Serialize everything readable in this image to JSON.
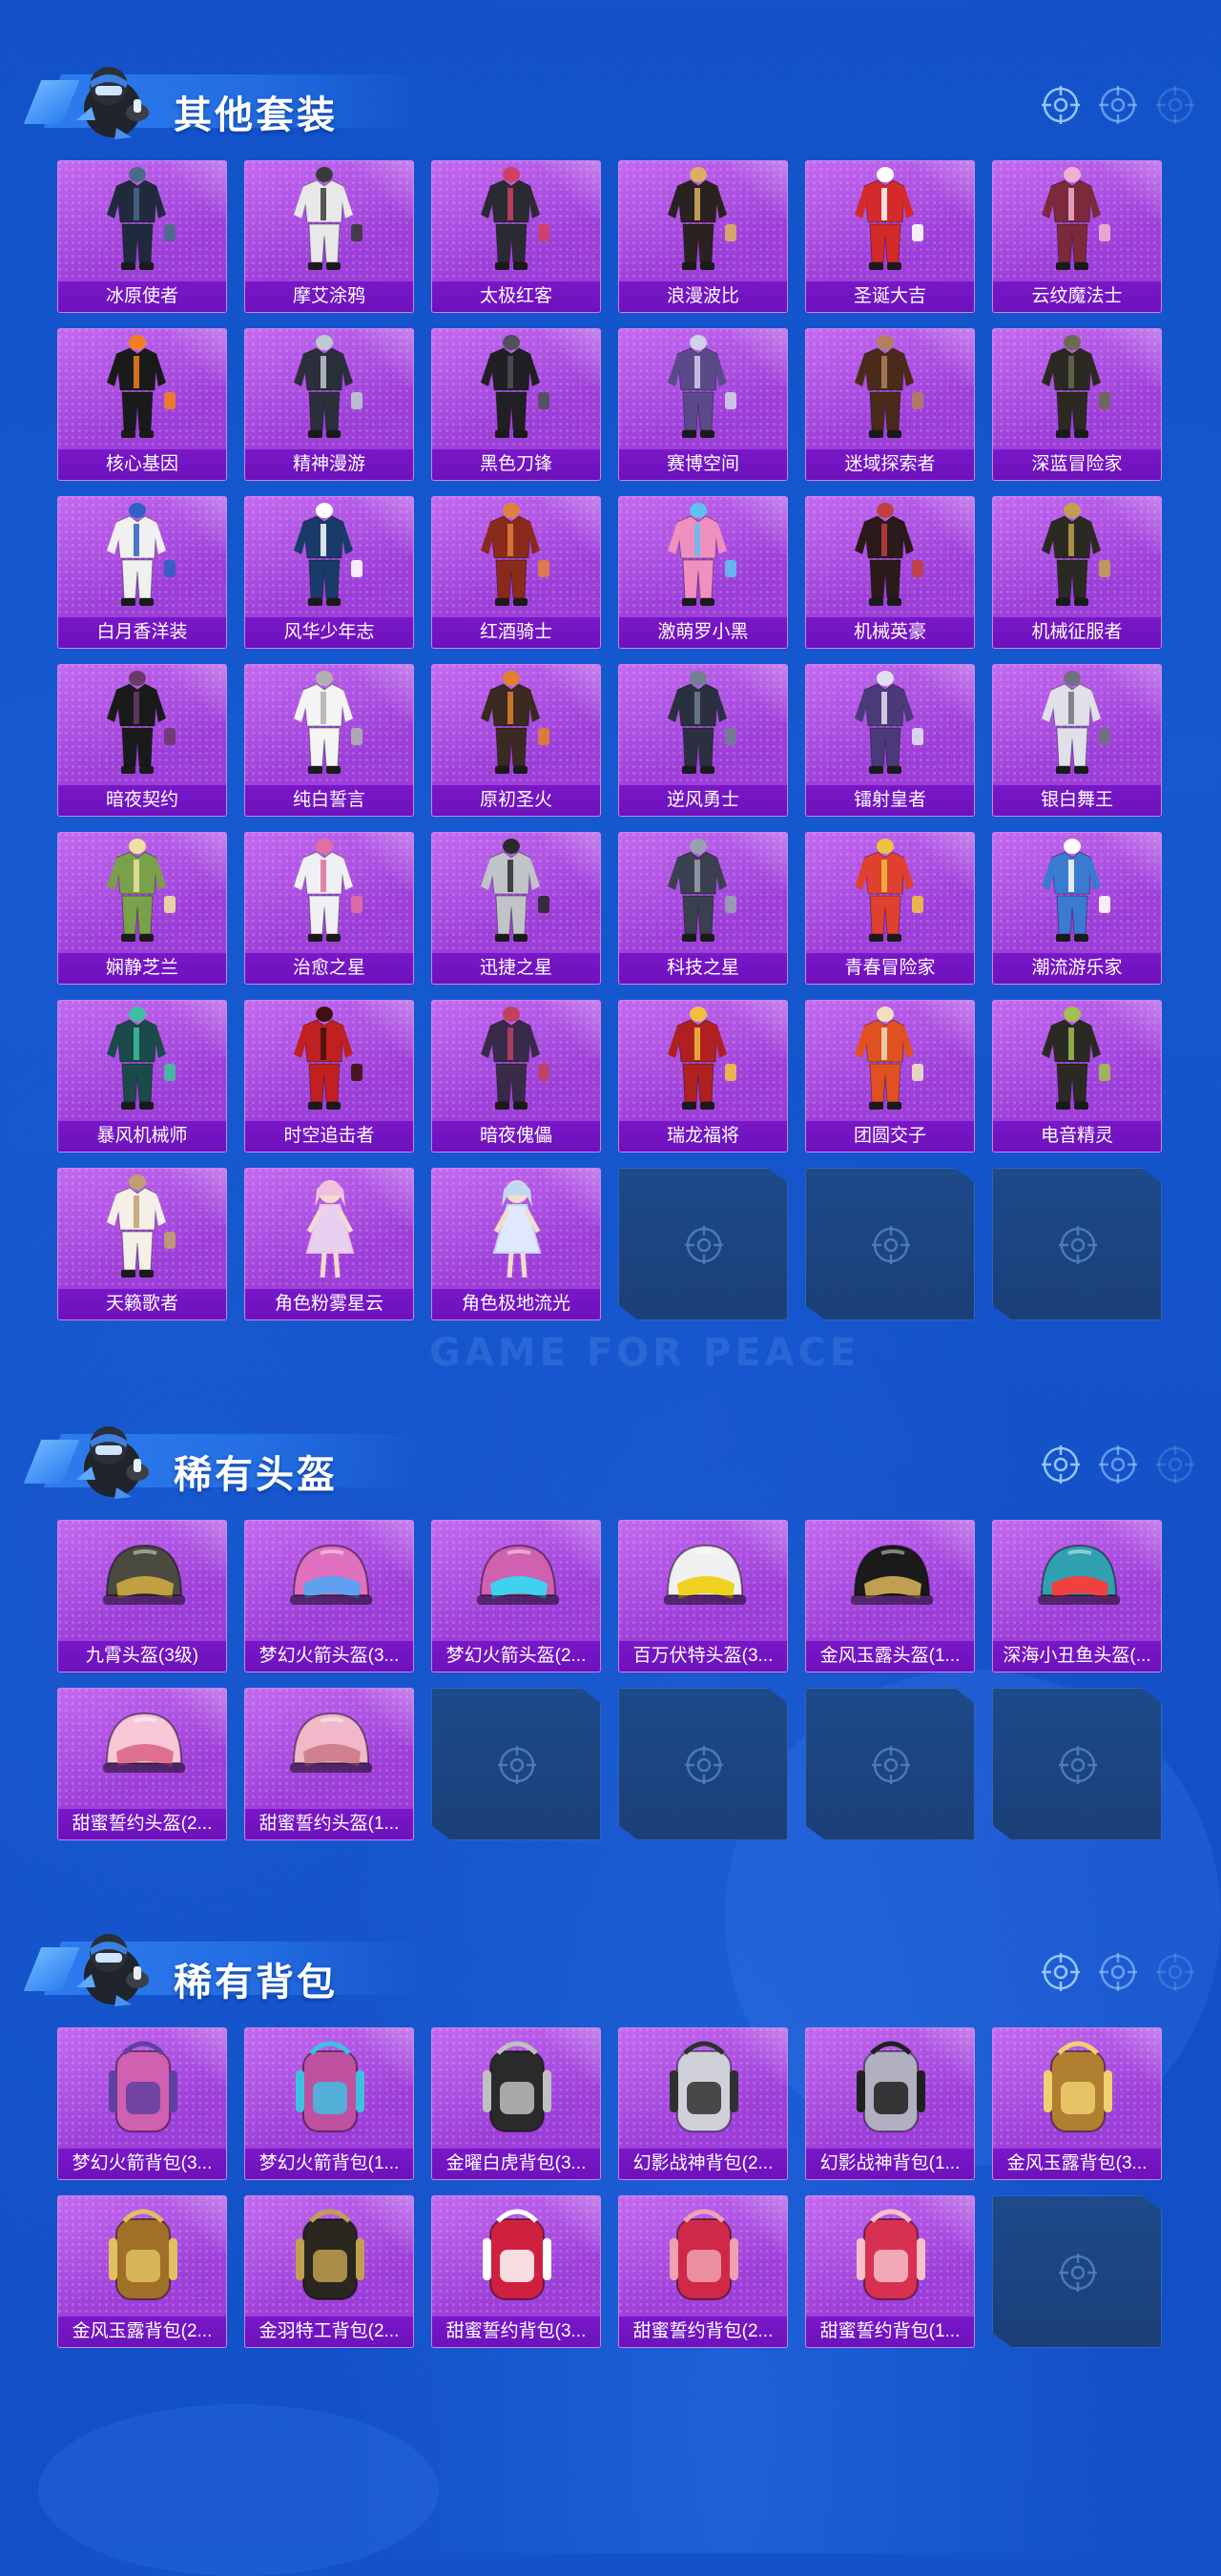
{
  "watermark": "GAME FOR PEACE",
  "colors": {
    "background": "#1352c9",
    "card_purple": "#a64bd9",
    "card_label": "#7a17c9",
    "empty_slot": "#1d4a8a",
    "accent_light": "#9ecbff"
  },
  "sections": [
    {
      "title": "其他套装",
      "icon": "mascot-icon",
      "items": [
        {
          "name": "冰原使者",
          "art": "outfit",
          "tone": "#1f2b3d",
          "accent": "#4a6a8a"
        },
        {
          "name": "摩艾涂鸦",
          "art": "outfit",
          "tone": "#e8e8e8",
          "accent": "#3a3a3a"
        },
        {
          "name": "太极红客",
          "art": "outfit",
          "tone": "#2a2a32",
          "accent": "#d04060"
        },
        {
          "name": "浪漫波比",
          "art": "outfit",
          "tone": "#2a2220",
          "accent": "#d8b060"
        },
        {
          "name": "圣诞大吉",
          "art": "outfit",
          "tone": "#d52a2a",
          "accent": "#ffffff"
        },
        {
          "name": "云纹魔法士",
          "art": "outfit",
          "tone": "#7a2a3a",
          "accent": "#f0b0d0"
        },
        {
          "name": "核心基因",
          "art": "outfit",
          "tone": "#1a1a1a",
          "accent": "#f08020"
        },
        {
          "name": "精神漫游",
          "art": "outfit",
          "tone": "#2a2f3a",
          "accent": "#c0c8d0"
        },
        {
          "name": "黑色刀锋",
          "art": "outfit",
          "tone": "#202024",
          "accent": "#505058"
        },
        {
          "name": "赛博空间",
          "art": "outfit",
          "tone": "#5a4a8a",
          "accent": "#d0d0e8"
        },
        {
          "name": "迷域探索者",
          "art": "outfit",
          "tone": "#4a2a1a",
          "accent": "#b08060"
        },
        {
          "name": "深蓝冒险家",
          "art": "outfit",
          "tone": "#2a2a22",
          "accent": "#6a6a50"
        },
        {
          "name": "白月香洋装",
          "art": "outfit",
          "tone": "#f0f0f0",
          "accent": "#3060c0"
        },
        {
          "name": "风华少年志",
          "art": "outfit",
          "tone": "#1a3a6a",
          "accent": "#ffffff"
        },
        {
          "name": "红酒骑士",
          "art": "outfit",
          "tone": "#8a2a1a",
          "accent": "#e08040"
        },
        {
          "name": "激萌罗小黑",
          "art": "outfit",
          "tone": "#f090c0",
          "accent": "#60c0f0"
        },
        {
          "name": "机械英豪",
          "art": "outfit",
          "tone": "#2a1a1a",
          "accent": "#c04040"
        },
        {
          "name": "机械征服者",
          "art": "outfit",
          "tone": "#2a2a22",
          "accent": "#c0a050"
        },
        {
          "name": "暗夜契约",
          "art": "outfit",
          "tone": "#1a1a1a",
          "accent": "#6a3a6a"
        },
        {
          "name": "纯白誓言",
          "art": "outfit",
          "tone": "#f4f4f4",
          "accent": "#b0b0b0"
        },
        {
          "name": "原初圣火",
          "art": "outfit",
          "tone": "#3a2a22",
          "accent": "#e08030"
        },
        {
          "name": "逆风勇士",
          "art": "outfit",
          "tone": "#2a3040",
          "accent": "#708090"
        },
        {
          "name": "镭射皇者",
          "art": "outfit",
          "tone": "#4a3a7a",
          "accent": "#e0e0f0"
        },
        {
          "name": "银白舞王",
          "art": "outfit",
          "tone": "#e0e0e8",
          "accent": "#707080"
        },
        {
          "name": "娴静芝兰",
          "art": "outfit",
          "tone": "#7aa04a",
          "accent": "#f0e0a0"
        },
        {
          "name": "治愈之星",
          "art": "outfit",
          "tone": "#f0f0f4",
          "accent": "#e070a0"
        },
        {
          "name": "迅捷之星",
          "art": "outfit",
          "tone": "#c0c4c8",
          "accent": "#2a2a2a"
        },
        {
          "name": "科技之星",
          "art": "outfit",
          "tone": "#3a4050",
          "accent": "#9aa0b0"
        },
        {
          "name": "青春冒险家",
          "art": "outfit",
          "tone": "#e04030",
          "accent": "#f0c040"
        },
        {
          "name": "潮流游乐家",
          "art": "outfit",
          "tone": "#3a7ad0",
          "accent": "#ffffff"
        },
        {
          "name": "暴风机械师",
          "art": "outfit",
          "tone": "#1a4a4a",
          "accent": "#40c0a0"
        },
        {
          "name": "时空追击者",
          "art": "outfit",
          "tone": "#c02020",
          "accent": "#401010"
        },
        {
          "name": "暗夜傀儡",
          "art": "outfit",
          "tone": "#3a2a4a",
          "accent": "#c04060"
        },
        {
          "name": "瑞龙福将",
          "art": "outfit",
          "tone": "#b02020",
          "accent": "#f0c040"
        },
        {
          "name": "团圆交子",
          "art": "outfit",
          "tone": "#e05020",
          "accent": "#f0e0c0"
        },
        {
          "name": "电音精灵",
          "art": "outfit",
          "tone": "#2a2a24",
          "accent": "#a0c050"
        },
        {
          "name": "天籁歌者",
          "art": "outfit",
          "tone": "#f4f0e8",
          "accent": "#c0a070"
        },
        {
          "name": "角色粉雾星云",
          "art": "figure",
          "tone": "#f0c0e0",
          "accent": "#e8d0f0"
        },
        {
          "name": "角色极地流光",
          "art": "figure",
          "tone": "#c0d8f0",
          "accent": "#e0e8ff"
        },
        {
          "empty": true
        },
        {
          "empty": true
        },
        {
          "empty": true
        }
      ]
    },
    {
      "title": "稀有头盔",
      "icon": "mascot-icon",
      "items": [
        {
          "name": "九霄头盔(3级)",
          "art": "helmet",
          "tone": "#4a4a40",
          "accent": "#c0a040"
        },
        {
          "name": "梦幻火箭头盔(3...",
          "art": "helmet",
          "tone": "#e070c0",
          "accent": "#60a0f0"
        },
        {
          "name": "梦幻火箭头盔(2...",
          "art": "helmet",
          "tone": "#d060b0",
          "accent": "#40d0f0"
        },
        {
          "name": "百万伏特头盔(3...",
          "art": "helmet",
          "tone": "#f0f0f0",
          "accent": "#f0d020"
        },
        {
          "name": "金风玉露头盔(1...",
          "art": "helmet",
          "tone": "#1a1a1a",
          "accent": "#c0a050"
        },
        {
          "name": "深海小丑鱼头盔(...",
          "art": "helmet",
          "tone": "#30a0b0",
          "accent": "#f04040"
        },
        {
          "name": "甜蜜誓约头盔(2...",
          "art": "helmet",
          "tone": "#f8c8d8",
          "accent": "#e07090"
        },
        {
          "name": "甜蜜誓约头盔(1...",
          "art": "helmet",
          "tone": "#f0b8c8",
          "accent": "#d08090"
        },
        {
          "empty": true
        },
        {
          "empty": true
        },
        {
          "empty": true
        },
        {
          "empty": true
        }
      ]
    },
    {
      "title": "稀有背包",
      "icon": "mascot-icon",
      "items": [
        {
          "name": "梦幻火箭背包(3...",
          "art": "backpack",
          "tone": "#d060b0",
          "accent": "#6040a0"
        },
        {
          "name": "梦幻火箭背包(1...",
          "art": "backpack",
          "tone": "#c050a0",
          "accent": "#40c0e0"
        },
        {
          "name": "金曜白虎背包(3...",
          "art": "backpack",
          "tone": "#2a2a2a",
          "accent": "#c0c0c0"
        },
        {
          "name": "幻影战神背包(2...",
          "art": "backpack",
          "tone": "#d0d0d8",
          "accent": "#303030"
        },
        {
          "name": "幻影战神背包(1...",
          "art": "backpack",
          "tone": "#b0b0c0",
          "accent": "#202020"
        },
        {
          "name": "金风玉露背包(3...",
          "art": "backpack",
          "tone": "#b08030",
          "accent": "#f0d070"
        },
        {
          "name": "金风玉露背包(2...",
          "art": "backpack",
          "tone": "#a07028",
          "accent": "#e0c060"
        },
        {
          "name": "金羽特工背包(2...",
          "art": "backpack",
          "tone": "#2a2620",
          "accent": "#c0a050"
        },
        {
          "name": "甜蜜誓约背包(3...",
          "art": "backpack",
          "tone": "#d02040",
          "accent": "#ffffff"
        },
        {
          "name": "甜蜜誓约背包(2...",
          "art": "backpack",
          "tone": "#d02848",
          "accent": "#f0a0b0"
        },
        {
          "name": "甜蜜誓约背包(1...",
          "art": "backpack",
          "tone": "#d83050",
          "accent": "#f8c0c8"
        },
        {
          "empty": true
        }
      ]
    }
  ]
}
